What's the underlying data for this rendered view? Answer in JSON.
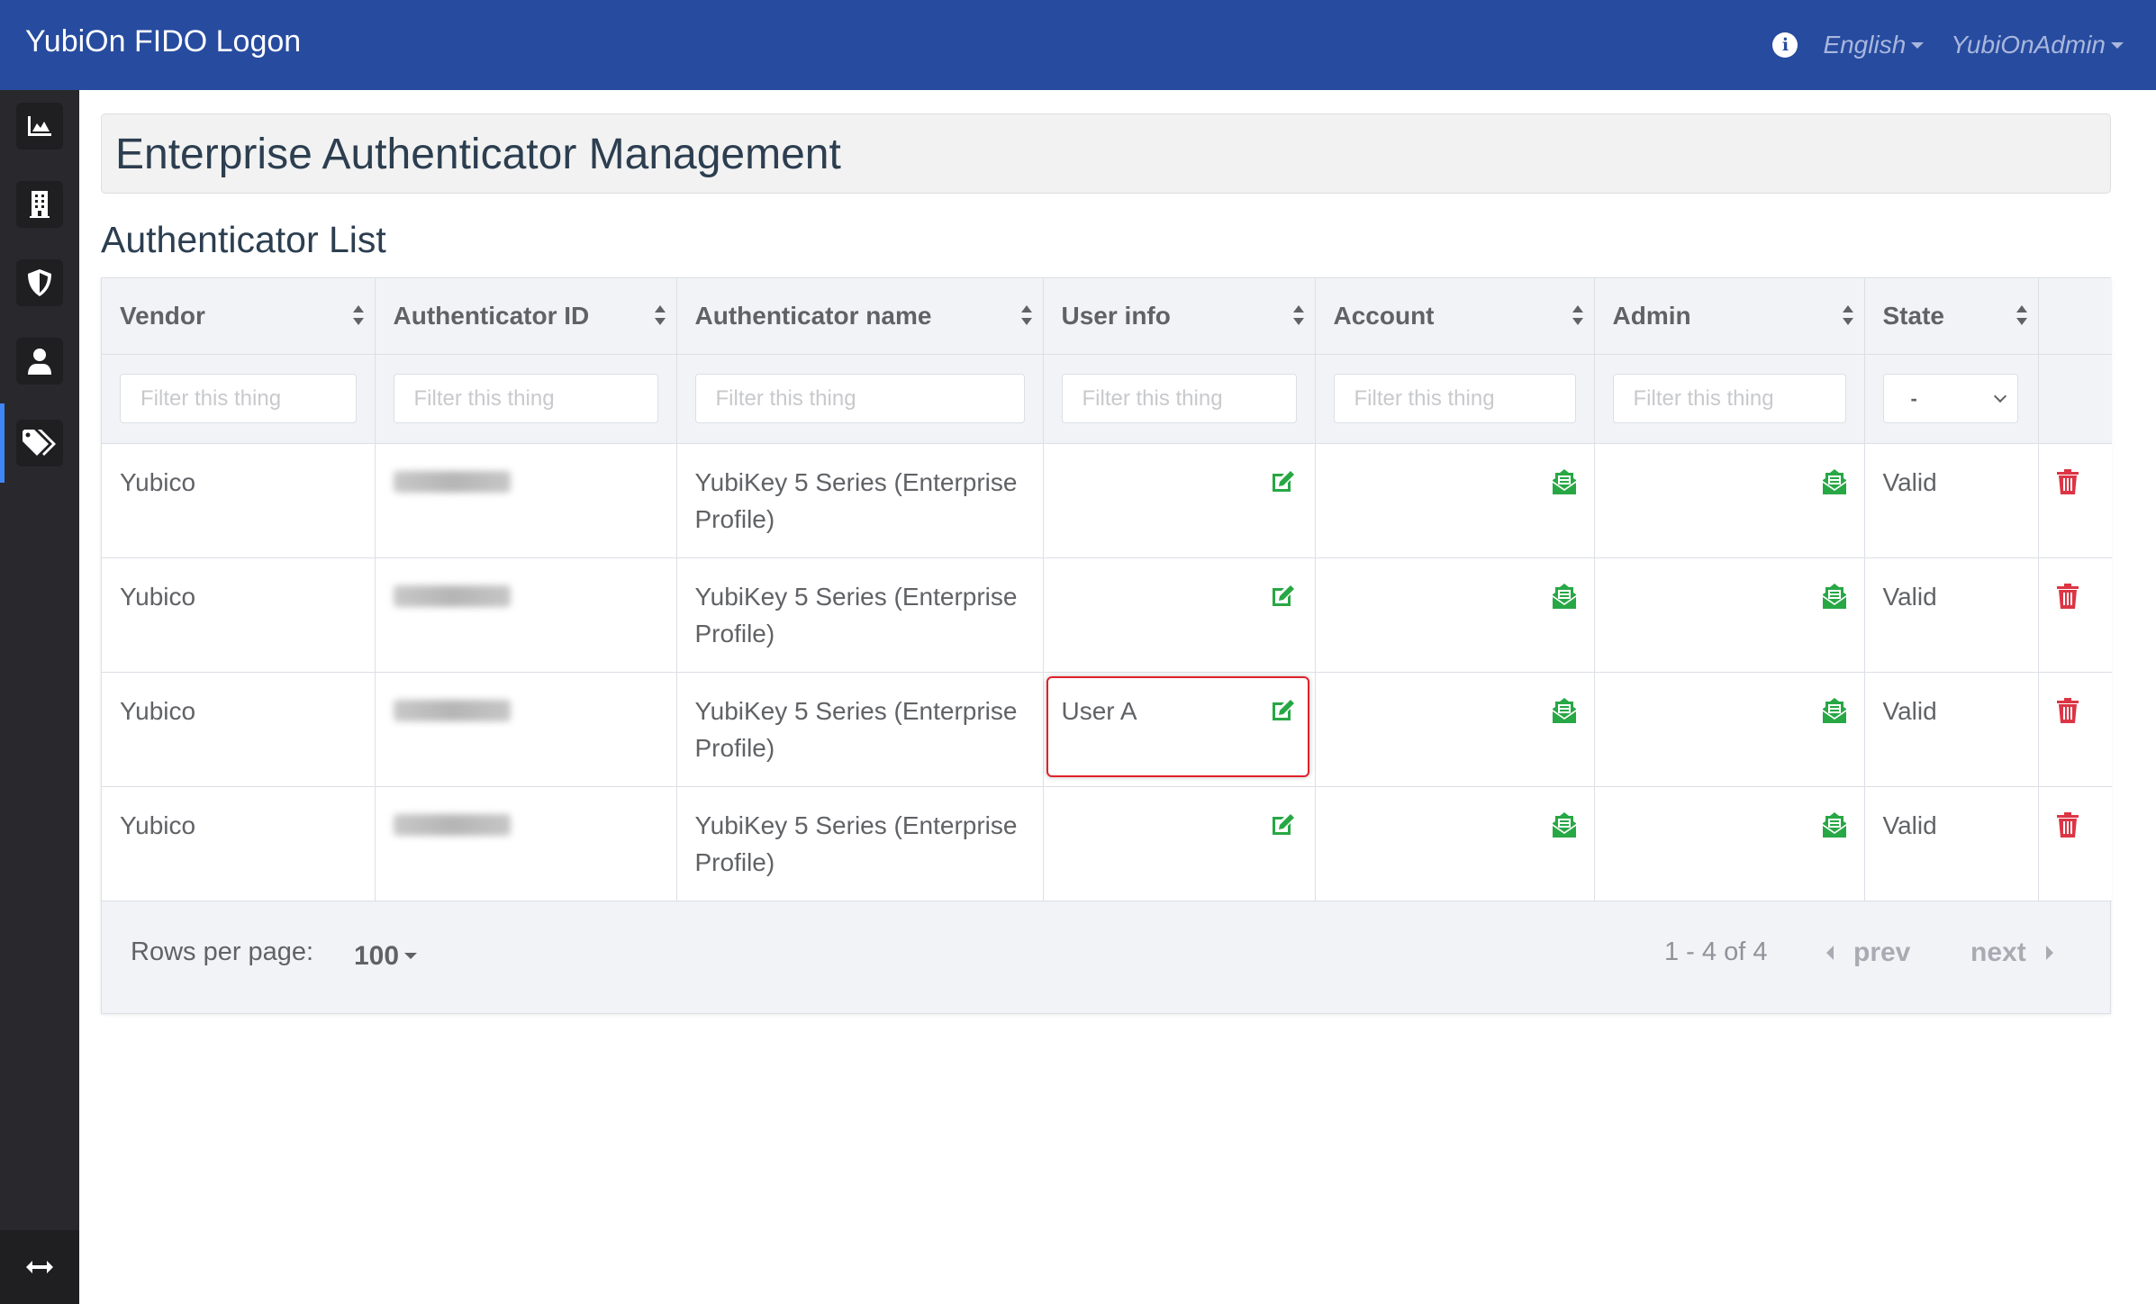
{
  "app": {
    "title": "YubiOn FIDO Logon",
    "language": "English",
    "user": "YubiOnAdmin"
  },
  "sidebar": {
    "items": [
      {
        "name": "dashboard",
        "icon": "chart-area-icon"
      },
      {
        "name": "organization",
        "icon": "building-icon"
      },
      {
        "name": "security",
        "icon": "shield-icon"
      },
      {
        "name": "users",
        "icon": "user-icon"
      },
      {
        "name": "authenticators",
        "icon": "tags-icon",
        "active": true
      }
    ],
    "toggle_icon": "arrows-horizontal-icon"
  },
  "page": {
    "title": "Enterprise Authenticator Management",
    "section_title": "Authenticator List"
  },
  "table": {
    "columns": [
      "Vendor",
      "Authenticator ID",
      "Authenticator name",
      "User info",
      "Account",
      "Admin",
      "State",
      ""
    ],
    "filter_placeholder": "Filter this thing",
    "state_filter_value": "-",
    "rows": [
      {
        "vendor": "Yubico",
        "auth_id": "[redacted]",
        "auth_name": "YubiKey 5 Series (Enterprise Profile)",
        "user_info": "",
        "state": "Valid"
      },
      {
        "vendor": "Yubico",
        "auth_id": "[redacted]",
        "auth_name": "YubiKey 5 Series (Enterprise Profile)",
        "user_info": "",
        "state": "Valid"
      },
      {
        "vendor": "Yubico",
        "auth_id": "[redacted]",
        "auth_name": "YubiKey 5 Series (Enterprise Profile)",
        "user_info": "User A",
        "state": "Valid",
        "highlighted": true
      },
      {
        "vendor": "Yubico",
        "auth_id": "[redacted]",
        "auth_name": "YubiKey 5 Series (Enterprise Profile)",
        "user_info": "",
        "state": "Valid"
      }
    ]
  },
  "pagination": {
    "rows_per_page_label": "Rows per page:",
    "rows_per_page_value": "100",
    "range": "1 - 4 of 4",
    "prev": "prev",
    "next": "next"
  },
  "colors": {
    "header_bg": "#274b9f",
    "sidebar_bg": "#29292d",
    "active_indicator": "#3f86f7",
    "action_green": "#28a745",
    "delete_red": "#dc3545",
    "highlight_red": "#e0202a"
  }
}
